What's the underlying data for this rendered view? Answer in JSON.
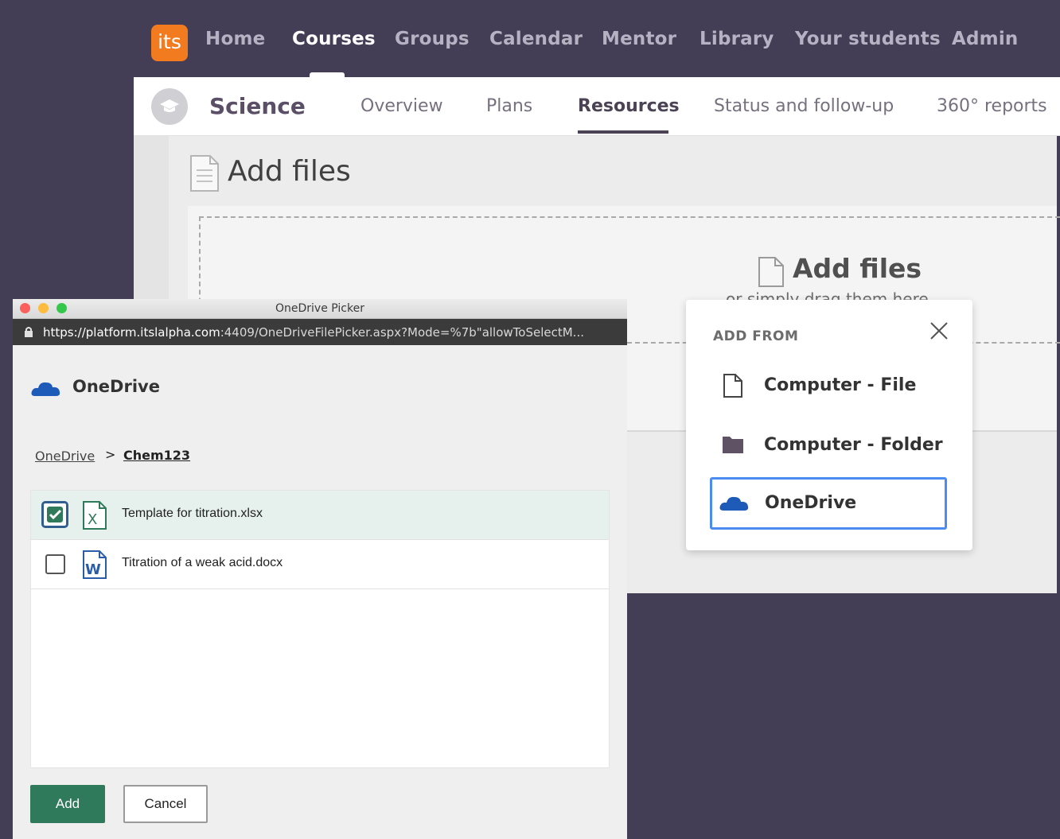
{
  "navbar": {
    "logo_text": "its",
    "items": [
      {
        "label": "Home"
      },
      {
        "label": "Courses"
      },
      {
        "label": "Groups"
      },
      {
        "label": "Calendar"
      },
      {
        "label": "Mentor"
      },
      {
        "label": "Library"
      },
      {
        "label": "Your students"
      },
      {
        "label": "Admin"
      }
    ],
    "active": "Courses"
  },
  "course": {
    "title": "Science",
    "tabs": [
      {
        "label": "Overview"
      },
      {
        "label": "Plans"
      },
      {
        "label": "Resources"
      },
      {
        "label": "Status and follow-up"
      },
      {
        "label": "360° reports"
      }
    ],
    "active_tab": "Resources"
  },
  "main": {
    "page_title": "Add files",
    "drop_zone": {
      "title": "Add files",
      "subtitle": "or simply drag them here"
    }
  },
  "add_from": {
    "heading": "ADD FROM",
    "options": [
      {
        "label": "Computer - File",
        "icon": "file-icon"
      },
      {
        "label": "Computer - Folder",
        "icon": "folder-icon"
      },
      {
        "label": "OneDrive",
        "icon": "onedrive-icon"
      }
    ],
    "selected": "OneDrive"
  },
  "picker": {
    "window_title": "OneDrive Picker",
    "url_host": "https://platform.itslalpha.com",
    "url_rest": ":4409/OneDriveFilePicker.aspx?Mode=%7b\"allowToSelectM...",
    "brand": "OneDrive",
    "breadcrumb": {
      "root": "OneDrive",
      "separator": ">",
      "current": "Chem123"
    },
    "files": [
      {
        "name": "Template for titration.xlsx",
        "type": "excel",
        "checked": true
      },
      {
        "name": "Titration of a weak acid.docx",
        "type": "word",
        "checked": false
      }
    ],
    "add_label": "Add",
    "cancel_label": "Cancel"
  },
  "colors": {
    "nav_bg": "#433d55",
    "logo": "#f27a1f",
    "accent_green": "#2f7a5a",
    "onedrive_blue": "#1e5bb8",
    "focus_blue": "#4a8cf0"
  }
}
